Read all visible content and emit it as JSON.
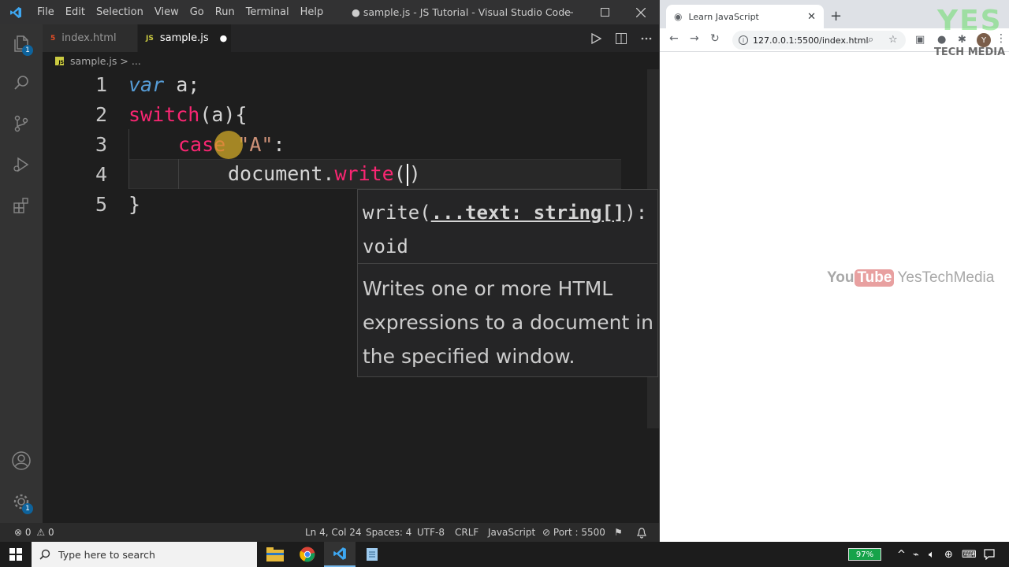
{
  "vscode": {
    "menu": [
      "File",
      "Edit",
      "Selection",
      "View",
      "Go",
      "Run",
      "Terminal",
      "Help"
    ],
    "window_title": "● sample.js - JS Tutorial - Visual Studio Code",
    "explorer_badge": "1",
    "settings_badge": "1",
    "tabs": [
      {
        "label": "index.html",
        "icon": "html5-icon",
        "icon_text": "5"
      },
      {
        "label": "sample.js",
        "icon": "js-icon",
        "icon_text": "JS",
        "dirty": "●"
      }
    ],
    "breadcrumb": {
      "file": "sample.js",
      "sep": ">",
      "rest": "..."
    },
    "line_numbers": [
      "1",
      "2",
      "3",
      "4",
      "5"
    ],
    "code": {
      "l1_kw": "var",
      "l1_rest": " a;",
      "l2_kw": "switch",
      "l2_rest": "(a){",
      "l3_kw": "case",
      "l3_sp": " ",
      "l3_str": "\"A\"",
      "l3_rest": ":",
      "l4_obj": "document.",
      "l4_fn": "write",
      "l4_open": "(",
      "l4_close": ")",
      "l5": "}"
    },
    "hover": {
      "sig_fn": "write(",
      "sig_param": "...text: string[]",
      "sig_rest": "): void",
      "doc": "Writes one or more HTML expressions to a document in the specified window."
    },
    "status": {
      "errors": "0",
      "warnings": "0",
      "position": "Ln 4, Col 24",
      "spaces": "Spaces: 4",
      "encoding": "UTF-8",
      "eol": "CRLF",
      "language": "JavaScript",
      "port": "Port : 5500"
    },
    "colors": {
      "accent": "#0e639c",
      "keyword_pink": "#f92672",
      "function": "#dcdcaa"
    }
  },
  "browser": {
    "tab_title": "Learn JavaScript",
    "url": "127.0.0.1:5500/index.html",
    "avatar": "Y",
    "watermark_yes": "YES",
    "watermark_tech": "TECH MEDIA",
    "yt_you": "You",
    "yt_tube": "Tube",
    "yt_channel": "YesTechMedia"
  },
  "taskbar": {
    "search_placeholder": "Type here to search",
    "battery": "97%"
  }
}
